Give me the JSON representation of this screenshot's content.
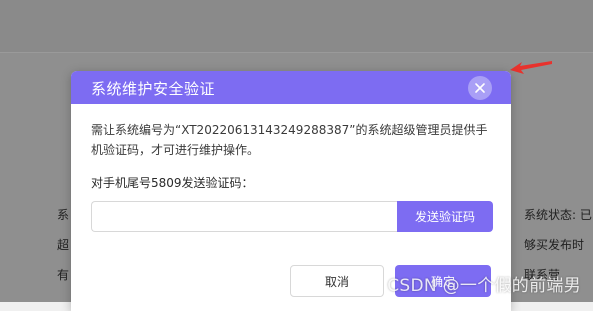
{
  "background": {
    "left_lines": [
      "系",
      "超",
      "有"
    ],
    "right_lines": [
      "系统状态: 已",
      "够买发布时",
      "联系营"
    ]
  },
  "modal": {
    "title": "系统维护安全验证",
    "description": "需让系统编号为“XT20220613143249288387”的系统超级管理员提供手机验证码，才可进行维护操作。",
    "phone_label": "对手机尾号5809发送验证码：",
    "code_input": {
      "value": "",
      "placeholder": ""
    },
    "send_code_label": "发送验证码",
    "cancel_label": "取消",
    "confirm_label": "确定"
  },
  "watermark": "CSDN @一个假的前端男",
  "colors": {
    "accent": "#7d6cf2",
    "annotation_arrow": "#e8322d"
  },
  "icons": {
    "close": "close-icon"
  }
}
